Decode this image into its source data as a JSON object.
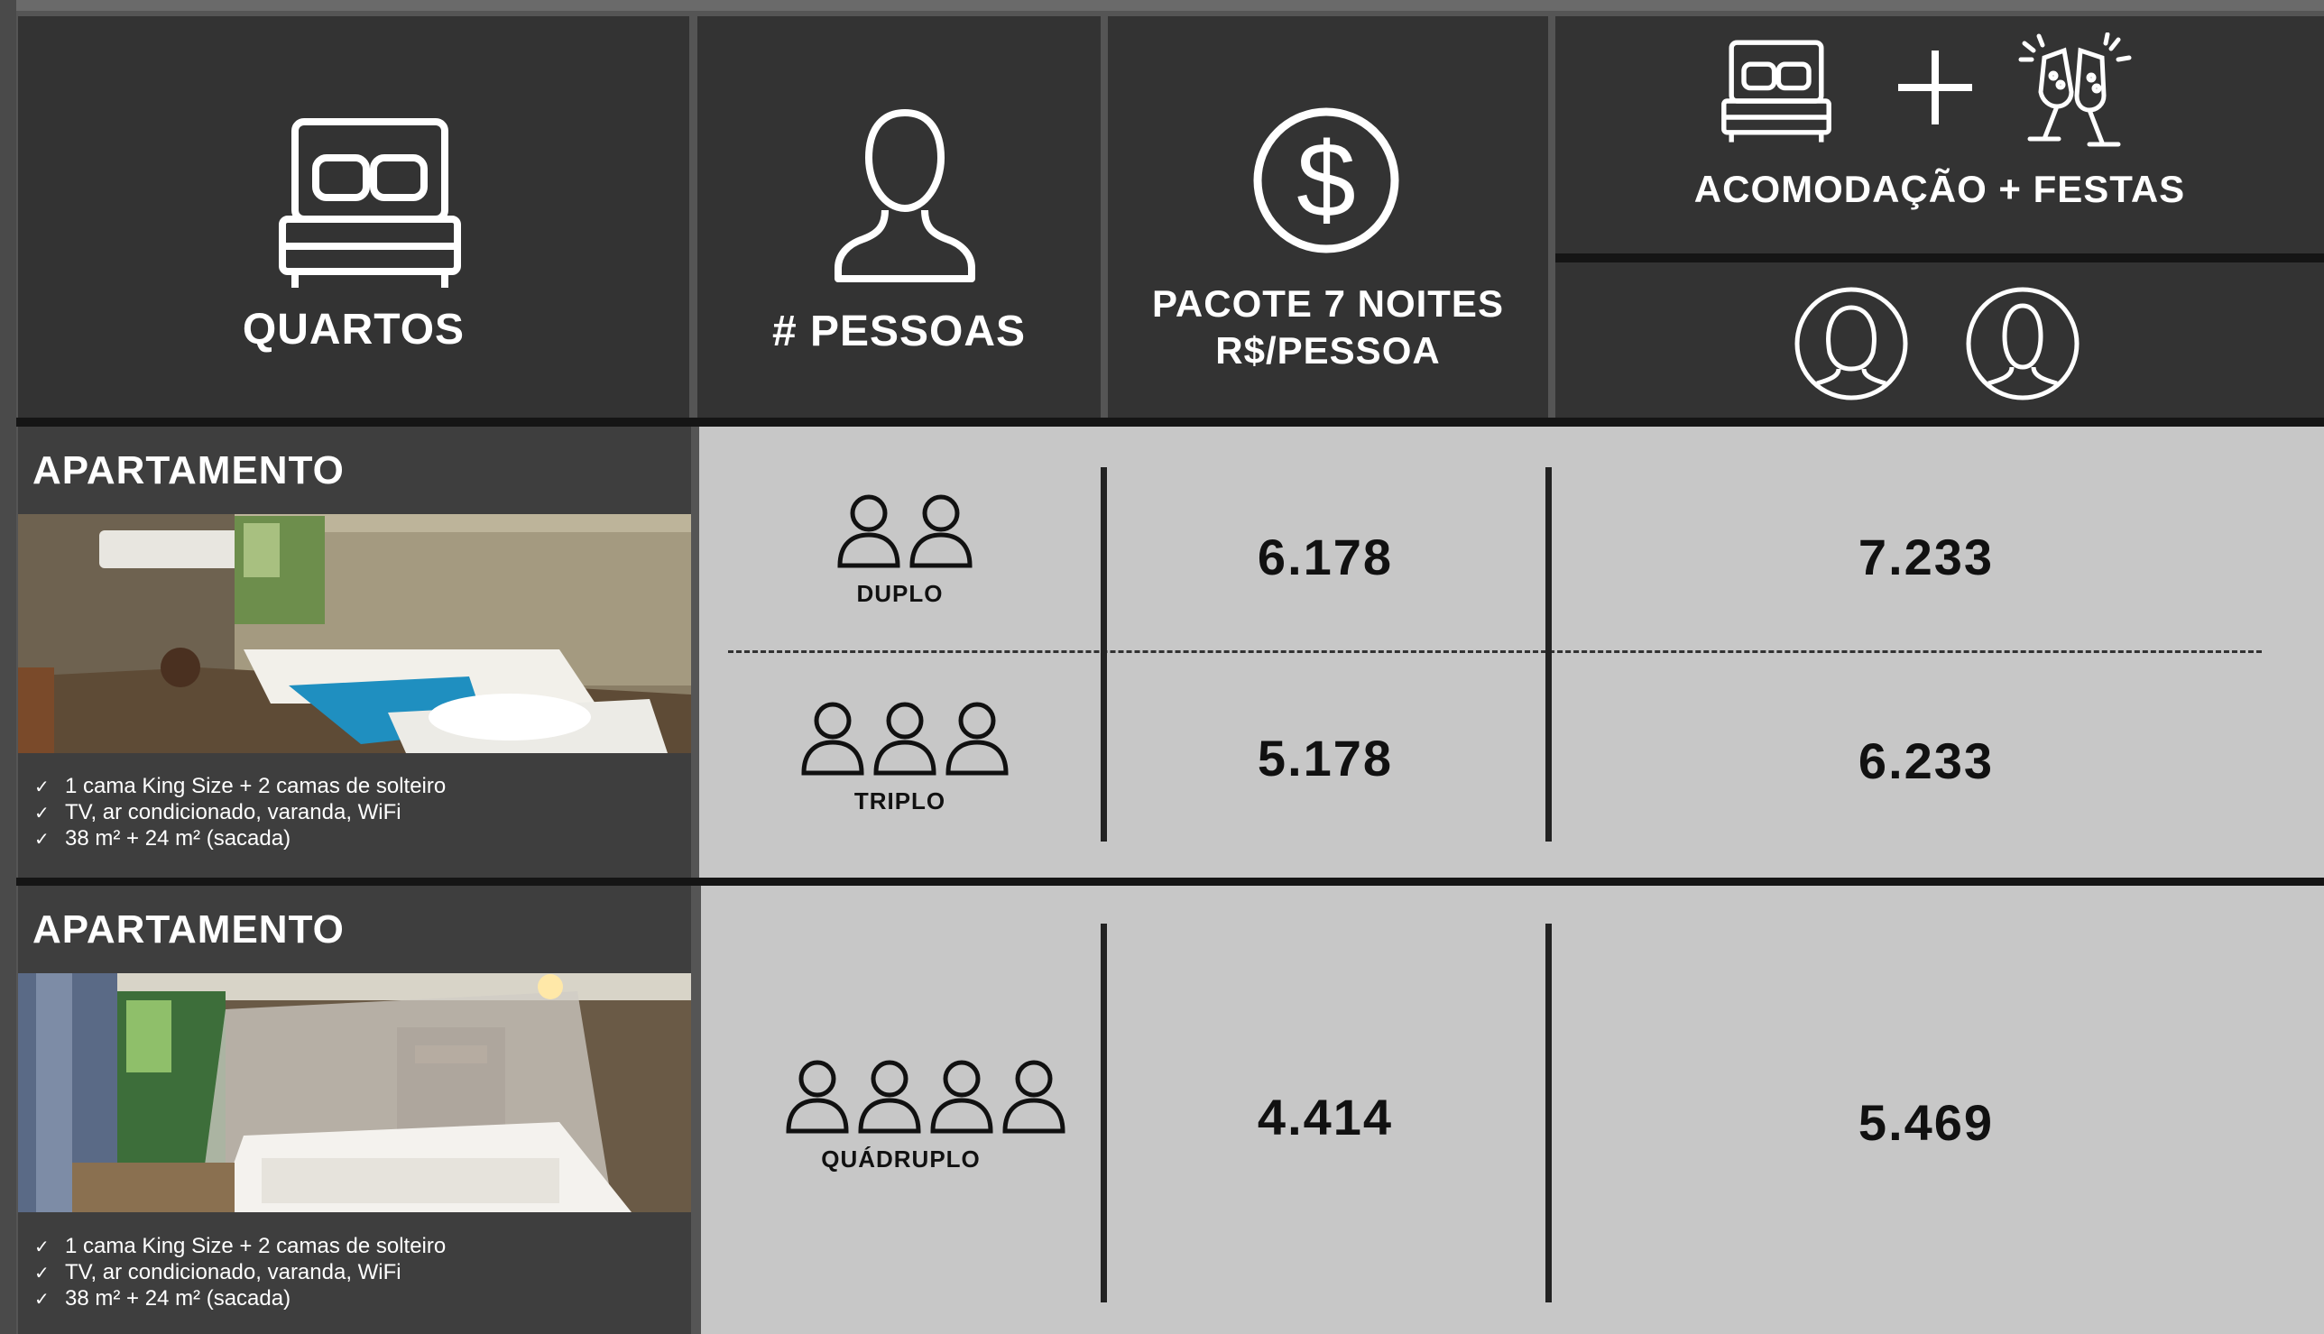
{
  "colors": {
    "header_bg": "#333333",
    "content_bg": "#c7c7c7",
    "divider": "#222222",
    "text_dark": "#111111",
    "text_light": "#ffffff"
  },
  "header": {
    "rooms": {
      "icon": "bed-icon",
      "label": "QUARTOS"
    },
    "people": {
      "icon": "person-icon",
      "label": "# PESSOAS"
    },
    "package": {
      "icon": "dollar-icon",
      "label_line1": "PACOTE 7 NOITES",
      "label_line2": "R$/PESSOA"
    },
    "combo": {
      "icons": [
        "bed-icon",
        "plus-icon",
        "champagne-icon"
      ],
      "label": "ACOMODAÇÃO + FESTAS",
      "sub_icons": [
        "female-avatar-icon",
        "male-avatar-icon"
      ]
    }
  },
  "rooms": [
    {
      "title": "APARTAMENTO",
      "photo_icon": "bedroom-photo",
      "features": [
        "1 cama King Size + 2 camas de solteiro",
        "TV, ar condicionado, varanda, WiFi",
        "38 m² + 24 m² (sacada)"
      ],
      "rates": [
        {
          "occupancy": "DUPLO",
          "people_icon_count": 2,
          "package_price": "6.178",
          "combo_price": "7.233"
        },
        {
          "occupancy": "TRIPLO",
          "people_icon_count": 3,
          "package_price": "5.178",
          "combo_price": "6.233"
        }
      ]
    },
    {
      "title": "APARTAMENTO",
      "photo_icon": "canopy-bed-photo",
      "features": [
        "1 cama King Size + 2 camas de solteiro",
        "TV, ar condicionado, varanda, WiFi",
        "38 m² + 24 m² (sacada)"
      ],
      "rates": [
        {
          "occupancy": "QUÁDRUPLO",
          "people_icon_count": 4,
          "package_price": "4.414",
          "combo_price": "5.469"
        }
      ]
    }
  ]
}
